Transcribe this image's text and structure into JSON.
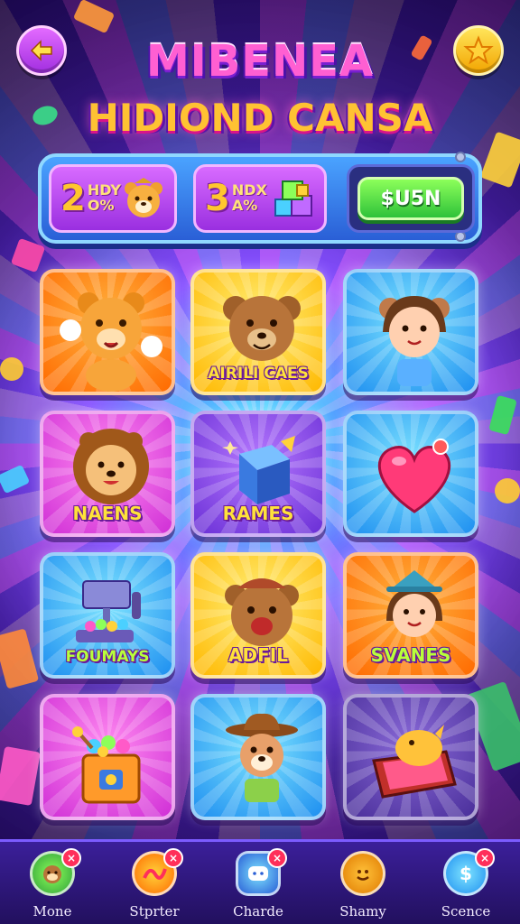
{
  "header": {
    "title_line1": "MIBENEA",
    "title_line2": "HIDIOND CANSA",
    "back_icon": "arrow-left-icon",
    "star_icon": "star-icon"
  },
  "stats": {
    "box1": {
      "big": "2",
      "small_top": "HDY",
      "small_bottom": "O%",
      "icon": "bear-face-icon"
    },
    "box2": {
      "big": "3",
      "small_top": "NDX",
      "small_bottom": "A%",
      "icon": "gift-cubes-icon"
    },
    "cash_button_label": "$U5N"
  },
  "grid": {
    "tiles": [
      {
        "label": "",
        "theme": "orange",
        "icon": "bear-waving-icon"
      },
      {
        "label": "AIRILI CAES",
        "theme": "yellow",
        "icon": "bear-face-icon"
      },
      {
        "label": "",
        "theme": "blue",
        "icon": "girl-bear-icon"
      },
      {
        "label": "NAENS",
        "theme": "pink",
        "icon": "lion-icon"
      },
      {
        "label": "RAMES",
        "theme": "purple",
        "icon": "cube-icon"
      },
      {
        "label": "",
        "theme": "blue",
        "icon": "heart-icon"
      },
      {
        "label": "FOUMAYS",
        "theme": "blue",
        "icon": "candy-machine-icon"
      },
      {
        "label": "ADFIL",
        "theme": "yellow",
        "icon": "bear-hat-icon"
      },
      {
        "label": "SVANES",
        "theme": "orange",
        "icon": "girl-hat-icon"
      },
      {
        "label": "",
        "theme": "pink",
        "icon": "treasure-box-icon"
      },
      {
        "label": "",
        "theme": "blue",
        "icon": "cowboy-dog-icon"
      },
      {
        "label": "",
        "theme": "violet",
        "icon": "chest-icon"
      }
    ]
  },
  "nav": {
    "items": [
      {
        "label": "Mone",
        "icon": "monkey-icon",
        "badge": "×"
      },
      {
        "label": "Stprter",
        "icon": "swirl-icon",
        "badge": "×"
      },
      {
        "label": "Charde",
        "icon": "chat-icon",
        "badge": "×"
      },
      {
        "label": "Shamy",
        "icon": "smiley-icon",
        "badge": ""
      },
      {
        "label": "Scence",
        "icon": "dollar-icon",
        "badge": "×"
      }
    ]
  }
}
